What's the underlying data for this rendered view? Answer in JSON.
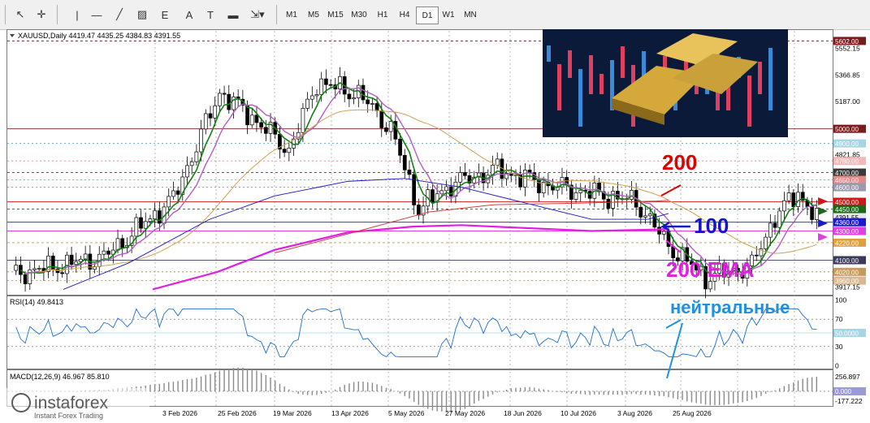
{
  "toolbar": {
    "tools": [
      {
        "name": "cursor-tool-button",
        "icon": "cursor-arrow-icon",
        "glyph": "↖"
      },
      {
        "name": "crosshair-tool-button",
        "icon": "crosshair-icon",
        "glyph": "✛"
      },
      {
        "name": "vertical-line-tool-button",
        "icon": "vertical-line-icon",
        "glyph": "|"
      },
      {
        "name": "horizontal-line-tool-button",
        "icon": "horizontal-line-icon",
        "glyph": "—"
      },
      {
        "name": "trendline-tool-button",
        "icon": "trendline-icon",
        "glyph": "╱"
      },
      {
        "name": "channel-tool-button",
        "icon": "channel-icon",
        "glyph": "▨"
      },
      {
        "name": "fibonacci-tool-button",
        "icon": "fibonacci-icon",
        "glyph": "Ε"
      },
      {
        "name": "text-tool-button",
        "icon": "text-icon",
        "glyph": "A"
      },
      {
        "name": "label-tool-button",
        "icon": "label-icon",
        "glyph": "T"
      },
      {
        "name": "rectangle-tool-button",
        "icon": "rectangle-icon",
        "glyph": "▬"
      },
      {
        "name": "arrows-tool-button",
        "icon": "arrows-icon",
        "glyph": "⇲▾"
      }
    ],
    "timeframes": [
      "M1",
      "M5",
      "M15",
      "M30",
      "H1",
      "H4",
      "D1",
      "W1",
      "MN"
    ],
    "active_timeframe": "D1"
  },
  "chart_header": "XAUUSD,Daily  4419.47 4435.25 4384.83 4391.55",
  "price_axis": {
    "ticks": [
      "5552.15",
      "5366.85",
      "5187.00",
      "4821.85",
      "3917.15"
    ],
    "levels": [
      {
        "label": "5602.00",
        "price": 5602,
        "bg": "#7a1a1a",
        "fg": "#ffffff"
      },
      {
        "label": "5000.00",
        "price": 5000,
        "bg": "#7a1a1a",
        "fg": "#ffffff"
      },
      {
        "label": "4900.00",
        "price": 4900,
        "bg": "#a6d6e6",
        "fg": "#ffffff"
      },
      {
        "label": "4780.00",
        "price": 4780,
        "bg": "#f4b8b8",
        "fg": "#ffffff"
      },
      {
        "label": "4700.00",
        "price": 4700,
        "bg": "#3a3a3a",
        "fg": "#ffffff"
      },
      {
        "label": "4650.00",
        "price": 4650,
        "bg": "#e88888",
        "fg": "#ffffff"
      },
      {
        "label": "4600.00",
        "price": 4600,
        "bg": "#9b9bb0",
        "fg": "#ffffff"
      },
      {
        "label": "4500.00",
        "price": 4500,
        "bg": "#d01818",
        "fg": "#ffffff"
      },
      {
        "label": "4450.00",
        "price": 4450,
        "bg": "#1a6a1a",
        "fg": "#ffffff"
      },
      {
        "label": "4391.55",
        "price": 4394,
        "bg": "#e8e8e8",
        "fg": "#000000"
      },
      {
        "label": "4360.00",
        "price": 4360,
        "bg": "#1a1ad0",
        "fg": "#ffffff"
      },
      {
        "label": "4300.00",
        "price": 4300,
        "bg": "#e040e0",
        "fg": "#ffffff"
      },
      {
        "label": "4220.00",
        "price": 4220,
        "bg": "#e0a040",
        "fg": "#ffffff"
      },
      {
        "label": "4100.00",
        "price": 4100,
        "bg": "#3a3a5a",
        "fg": "#ffffff"
      },
      {
        "label": "4020.00",
        "price": 4020,
        "bg": "#c89a5a",
        "fg": "#ffffff"
      },
      {
        "label": "3960.00",
        "price": 3960,
        "bg": "#d8b890",
        "fg": "#ffffff"
      }
    ]
  },
  "date_axis": [
    "3 Feb 2026",
    "25 Feb 2026",
    "19 Mar 2026",
    "13 Apr 2026",
    "5 May 2026",
    "27 May 2026",
    "18 Jun 2026",
    "10 Jul 2026",
    "3 Aug 2026",
    "25 Aug 2026"
  ],
  "rsi": {
    "header": "RSI(14) 49.8413",
    "ticks": [
      "100",
      "70",
      "30",
      "0"
    ],
    "level_label": "50.0000"
  },
  "macd": {
    "header": "MACD(12,26,9) 46.967 85.810",
    "ticks": [
      "256.897",
      "-177.222"
    ],
    "zero_label": "0.000"
  },
  "annotations": {
    "ema200": "200",
    "ema100": "100",
    "ema200_label": "200 EMA",
    "neutral": "нейтральные"
  },
  "colors": {
    "ema200_red": "#e00000",
    "ema100_blue": "#1414c8",
    "ema_magenta": "#e020e0",
    "neutral_blue": "#2090e0",
    "up_candle": "#ffffff",
    "down_candle": "#000000",
    "ma_green": "#108010",
    "ma_violet": "#b060c0",
    "ma_orange": "#d0a050"
  },
  "watermark": {
    "brand": "instaforex",
    "tagline": "Instant Forex Trading",
    "icon": "instaforex-logo-icon"
  },
  "inset_image": {
    "icon": "gold-bars-photo-icon"
  }
}
